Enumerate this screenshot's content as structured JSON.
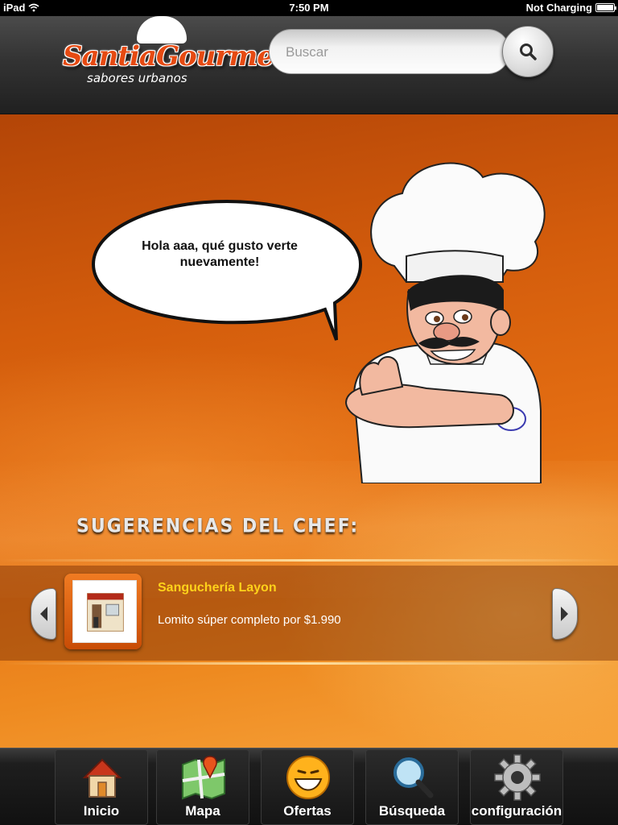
{
  "status_bar": {
    "device": "iPad",
    "time": "7:50 PM",
    "charging": "Not Charging"
  },
  "header": {
    "logo_name": "SantiaGourmet",
    "logo_tagline": "sabores urbanos",
    "search": {
      "placeholder": "Buscar",
      "button_icon": "search-icon"
    }
  },
  "greeting": {
    "line1": "Hola aaa, qué gusto verte",
    "line2": "nuevamente!"
  },
  "suggestions": {
    "heading": "SUGERENCIAS DEL CHEF:",
    "items": [
      {
        "title": "Sanguchería Layon",
        "description": "Lomito súper completo por $1.990"
      }
    ]
  },
  "tabbar": {
    "tabs": [
      {
        "label": "Inicio",
        "icon": "home-icon"
      },
      {
        "label": "Mapa",
        "icon": "map-icon"
      },
      {
        "label": "Ofertas",
        "icon": "smiley-icon"
      },
      {
        "label": "Búsqueda",
        "icon": "magnifier-icon"
      },
      {
        "label": "configuración",
        "icon": "gear-icon"
      }
    ]
  },
  "colors": {
    "brand_orange": "#e36d12",
    "title_yellow": "#ffd21a",
    "header_dark": "#2b2b2b"
  }
}
